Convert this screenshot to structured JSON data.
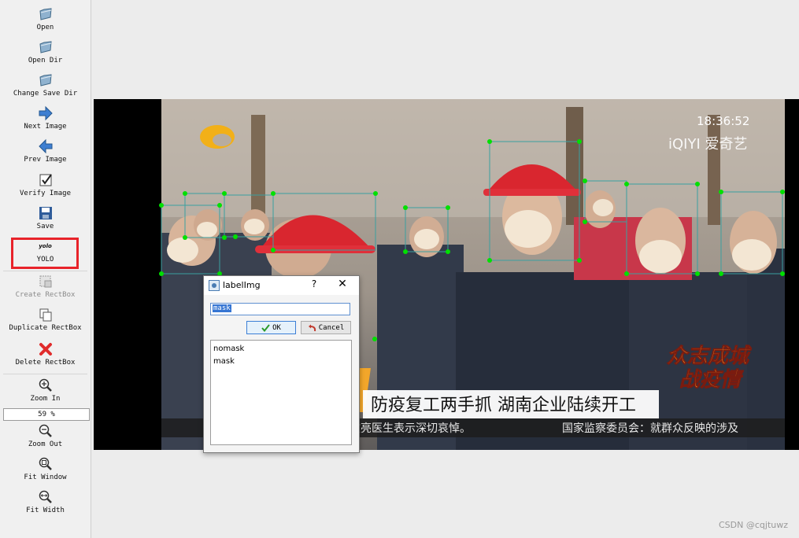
{
  "toolbar": {
    "open": "Open",
    "open_dir": "Open Dir",
    "change_save_dir": "Change Save Dir",
    "next_image": "Next Image",
    "prev_image": "Prev Image",
    "verify_image": "Verify Image",
    "save": "Save",
    "yolo_logo": "yolo",
    "yolo": "YOLO",
    "create_rectbox": "Create RectBox",
    "duplicate_rectbox": "Duplicate RectBox",
    "delete_rectbox": "Delete RectBox",
    "zoom_in": "Zoom In",
    "zoom_value": "59 %",
    "zoom_out": "Zoom Out",
    "fit_window": "Fit Window",
    "fit_width": "Fit Width"
  },
  "image_text": {
    "time": "18:36:52",
    "channel_logo": "iQIYI 爱奇艺",
    "slogan_1": "众志成城",
    "slogan_2": "战疫情",
    "headline": "防疫复工两手抓 湖南企业陆续开工",
    "ticker_left": "文亮医生表示深切哀悼。",
    "ticker_right": "国家监察委员会：就群众反映的涉及"
  },
  "dialog": {
    "title": "labelImg",
    "help": "?",
    "close": "✕",
    "input_value": "mask",
    "ok_label": "OK",
    "cancel_label": "Cancel",
    "labels": [
      "nomask",
      "mask"
    ]
  },
  "watermark": "CSDN @cqjtuwz",
  "colors": {
    "annotation_point": "#00e000",
    "annotation_box": "#3aa0a0",
    "highlight": "#e8232a",
    "selection": "#3575d3"
  }
}
